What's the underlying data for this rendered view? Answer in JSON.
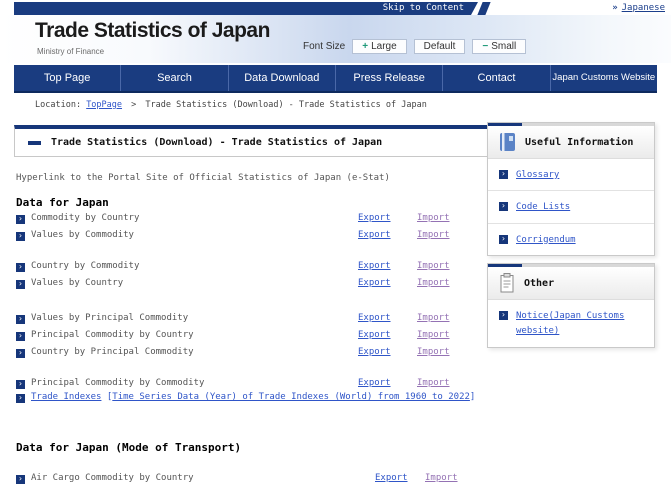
{
  "top_bar": {
    "skip_link": "Skip to Content",
    "language_link": "Japanese"
  },
  "header": {
    "site_title": "Trade Statistics of Japan",
    "site_subtitle": "Ministry of Finance",
    "font_size": {
      "label": "Font Size",
      "buttons": [
        {
          "sign": "+",
          "text": "Large"
        },
        {
          "sign": "",
          "text": "Default"
        },
        {
          "sign": "−",
          "text": "Small"
        }
      ]
    }
  },
  "nav": {
    "items": [
      {
        "label": "Top Page"
      },
      {
        "label": "Search"
      },
      {
        "label": "Data Download"
      },
      {
        "label": "Press Release"
      },
      {
        "label": "Contact"
      },
      {
        "label": "Japan Customs Website"
      }
    ]
  },
  "breadcrumb": {
    "prefix": "Location:",
    "home_link": "TopPage",
    "separator": ">",
    "current": "Trade Statistics (Download) - Trade Statistics of Japan"
  },
  "main": {
    "page_title": "Trade Statistics (Download) - Trade Statistics of Japan",
    "intro": "Hyperlink to the Portal Site of Official Statistics of Japan (e-Stat)",
    "section1": {
      "heading": "Data for Japan",
      "groups": [
        {
          "rows": [
            {
              "label": "Commodity by Country",
              "export": "Export",
              "import": "Import"
            },
            {
              "label": "Values by Commodity",
              "export": "Export",
              "import": "Import"
            }
          ]
        },
        {
          "rows": [
            {
              "label": "Country by Commodity",
              "export": "Export",
              "import": "Import"
            },
            {
              "label": "Values by Country",
              "export": "Export",
              "import": "Import"
            }
          ]
        },
        {
          "rows": [
            {
              "label": "Values by Principal Commodity",
              "export": "Export",
              "import": "Import"
            },
            {
              "label": "Principal Commodity by Country",
              "export": "Export",
              "import": "Import"
            },
            {
              "label": "Country by Principal Commodity",
              "export": "Export",
              "import": "Import"
            }
          ]
        },
        {
          "rows": [
            {
              "label": "Principal Commodity by Commodity",
              "export": "Export",
              "import": "Import"
            }
          ]
        }
      ],
      "trade_indexes": {
        "link": "Trade Indexes",
        "bracket_open": "[",
        "series_link": "Time Series Data (Year) of Trade Indexes (World) from 1960 to 2022",
        "bracket_close": "]"
      }
    },
    "section2": {
      "heading": "Data for Japan (Mode of Transport)",
      "rows": [
        {
          "label": "Air Cargo Commodity by Country",
          "export": "Export",
          "import": "Import"
        }
      ]
    }
  },
  "sidebar": {
    "useful_info": {
      "title": "Useful Information",
      "links": [
        {
          "label": "Glossary"
        },
        {
          "label": "Code Lists"
        },
        {
          "label": "Corrigendum"
        }
      ]
    },
    "other": {
      "title": "Other",
      "links": [
        {
          "label": "Notice(Japan Customs website)"
        }
      ]
    }
  },
  "colors": {
    "navy": "#17387c",
    "link_blue": "#2f55c8",
    "link_visited": "#9472b4"
  }
}
